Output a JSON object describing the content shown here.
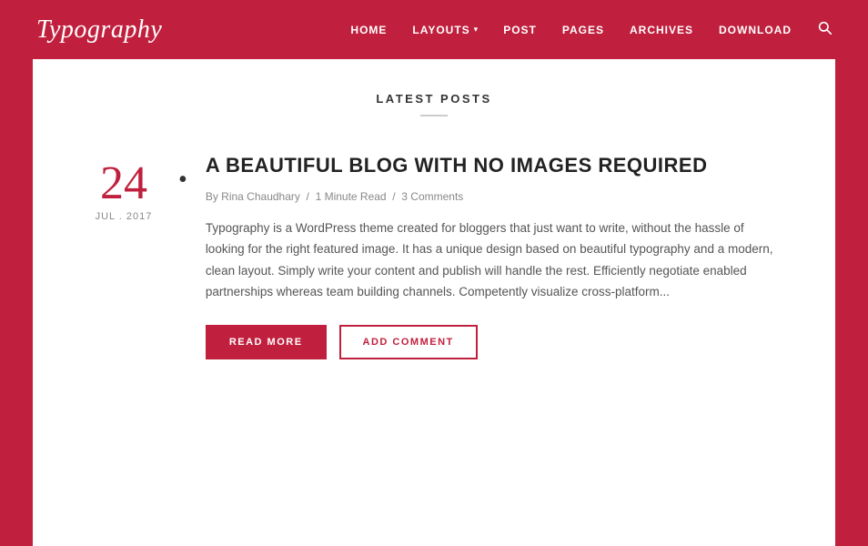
{
  "header": {
    "logo": "Typography",
    "nav": {
      "home": "HOME",
      "layouts": "LAYOUTS",
      "post": "POST",
      "pages": "PAGES",
      "archives": "ARCHIVES",
      "download": "DOWNLOAD"
    }
  },
  "section": {
    "title": "LATEST POSTS"
  },
  "post": {
    "date_number": "24",
    "date_month_year": "JUL . 2017",
    "title": "A BEAUTIFUL BLOG WITH NO IMAGES REQUIRED",
    "meta_by": "By",
    "meta_author": "Rina Chaudhary",
    "meta_read": "1 Minute Read",
    "meta_comments": "3 Comments",
    "excerpt": "Typography is a WordPress theme created for bloggers that just want to write, without the hassle of looking for the right featured image. It has a unique design based on beautiful typography and a modern, clean layout. Simply write your content and publish will handle the rest. Efficiently negotiate enabled partnerships whereas team building channels. Competently visualize cross-platform...",
    "btn_read_more": "READ MORE",
    "btn_add_comment": "ADD COMMENT"
  },
  "colors": {
    "brand_red": "#c0203e",
    "text_dark": "#222",
    "text_muted": "#888",
    "white": "#ffffff"
  }
}
